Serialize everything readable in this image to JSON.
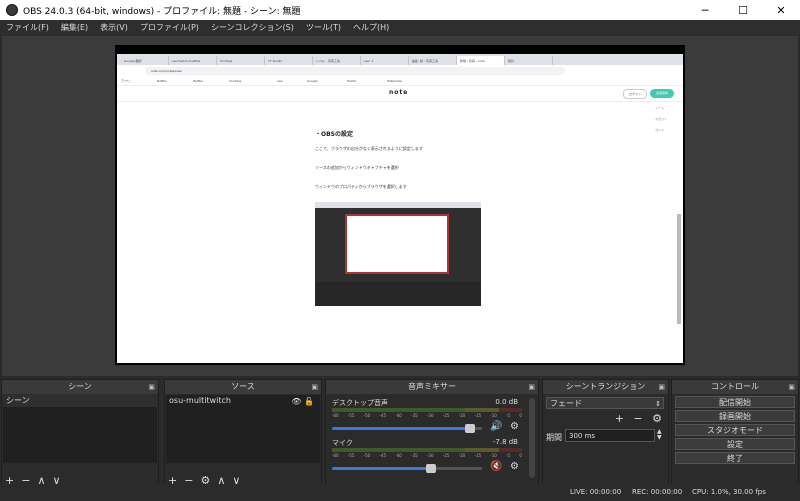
{
  "window": {
    "title": "OBS 24.0.3 (64-bit, windows) - プロファイル: 無題 - シーン: 無題",
    "controls": [
      "─",
      "☐",
      "✕"
    ]
  },
  "menu": [
    "ファイル(F)",
    "編集(E)",
    "表示(V)",
    "プロファイル(P)",
    "シーンコレクション(S)",
    "ツール(T)",
    "ヘルプ(H)"
  ],
  "preview": {
    "browser_tabs": [
      "Google 翻訳",
      "osu!twitch-multitw",
      "YouTube",
      "YT Studio",
      "レベル - 写真工房",
      "osu! 1",
      "編集: 動・写真工房",
      "新規 / 写真 - note",
      "統計"
    ],
    "url": "note.com/notes/new",
    "bookmarks": [
      "アプリ",
      "Netflix",
      "Twitter",
      "YouTube",
      "osu!",
      "Google",
      "Twitch",
      "Wikipedia"
    ],
    "note": {
      "logo": "note",
      "login": "ログイン",
      "register": "会員登録",
      "side_items": [
        "ノート",
        "マガジン",
        "ガイド"
      ],
      "heading": "・OBSの設定",
      "paragraphs": [
        "ここで、ブラウザの自分がなく表示されるように設定します",
        "ソースの追加からウィンドウキャプチャを選択",
        "ウィンドウのプロパティからブラウザを選択します"
      ]
    }
  },
  "docks": {
    "scenes": {
      "title": "シーン",
      "items": [
        "シーン"
      ],
      "tools": [
        "+",
        "−",
        "∧",
        "∨"
      ]
    },
    "sources": {
      "title": "ソース",
      "items": [
        "osu-multitwitch"
      ],
      "tools": [
        "+",
        "−",
        "⚙",
        "∧",
        "∨"
      ]
    },
    "mixer": {
      "title": "音声ミキサー",
      "ticks": [
        "-60",
        "-55",
        "-50",
        "-45",
        "-40",
        "-35",
        "-30",
        "-25",
        "-20",
        "-15",
        "-10",
        "-5",
        "0"
      ],
      "channels": [
        {
          "name": "デスクトップ音声",
          "db": "0.0 dB",
          "volume": 0.92,
          "muted": false
        },
        {
          "name": "マイク",
          "db": "-7.8 dB",
          "volume": 0.66,
          "muted": true
        }
      ]
    },
    "transitions": {
      "title": "シーントランジション",
      "selected": "フェード",
      "duration_label": "期間",
      "duration": "300 ms",
      "tools": [
        "+",
        "−",
        "⚙"
      ]
    },
    "controls": {
      "title": "コントロール",
      "buttons": [
        "配信開始",
        "録画開始",
        "スタジオモード",
        "設定",
        "終了"
      ]
    }
  },
  "status": {
    "live": "LIVE: 00:00:00",
    "rec": "REC: 00:00:00",
    "cpu": "CPU: 1.0%, 30.00 fps"
  }
}
